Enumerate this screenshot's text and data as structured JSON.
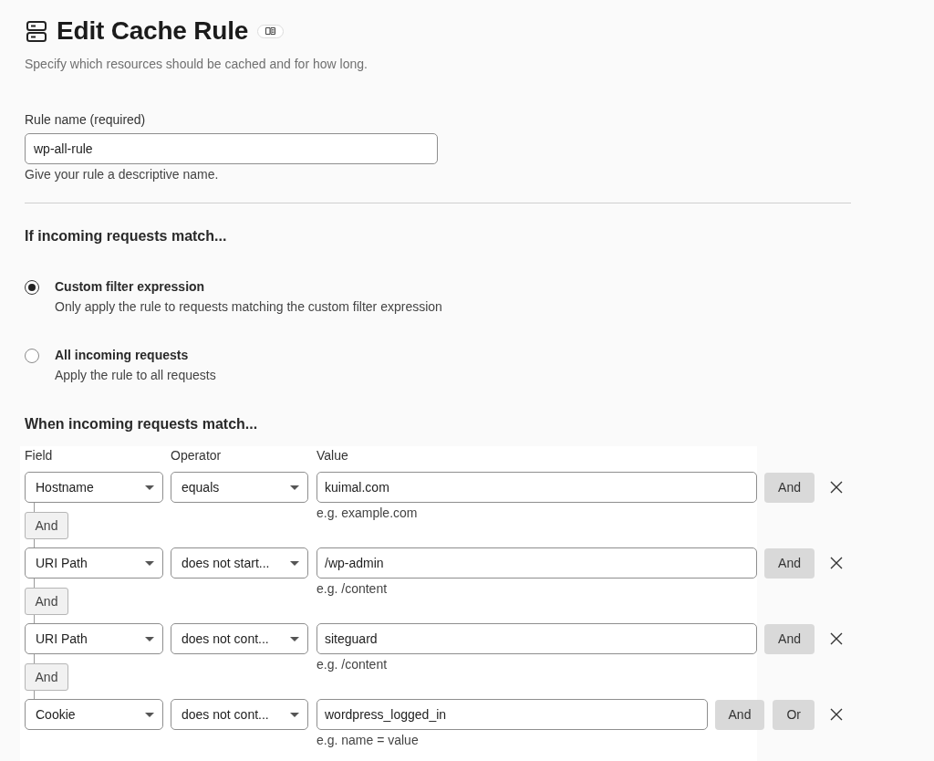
{
  "header": {
    "title": "Edit Cache Rule",
    "subtitle": "Specify which resources should be cached and for how long."
  },
  "rule_name": {
    "label": "Rule name (required)",
    "value": "wp-all-rule",
    "help": "Give your rule a descriptive name."
  },
  "request_match": {
    "heading": "If incoming requests match...",
    "options": [
      {
        "label": "Custom filter expression",
        "description": "Only apply the rule to requests matching the custom filter expression",
        "selected": true
      },
      {
        "label": "All incoming requests",
        "description": "Apply the rule to all requests",
        "selected": false
      }
    ]
  },
  "expression_builder": {
    "heading": "When incoming requests match...",
    "columns": [
      "Field",
      "Operator",
      "Value"
    ],
    "conditions": [
      {
        "field": "Hostname",
        "operator": "equals",
        "value": "kuimal.com",
        "hint": "e.g. example.com",
        "actions": [
          "And"
        ],
        "connector": "And"
      },
      {
        "field": "URI Path",
        "operator": "does not start...",
        "value": "/wp-admin",
        "hint": "e.g. /content",
        "actions": [
          "And"
        ],
        "connector": "And"
      },
      {
        "field": "URI Path",
        "operator": "does not cont...",
        "value": "siteguard",
        "hint": "e.g. /content",
        "actions": [
          "And"
        ],
        "connector": "And"
      },
      {
        "field": "Cookie",
        "operator": "does not cont...",
        "value": "wordpress_logged_in",
        "hint": "e.g. name = value",
        "actions": [
          "And",
          "Or"
        ]
      }
    ]
  }
}
